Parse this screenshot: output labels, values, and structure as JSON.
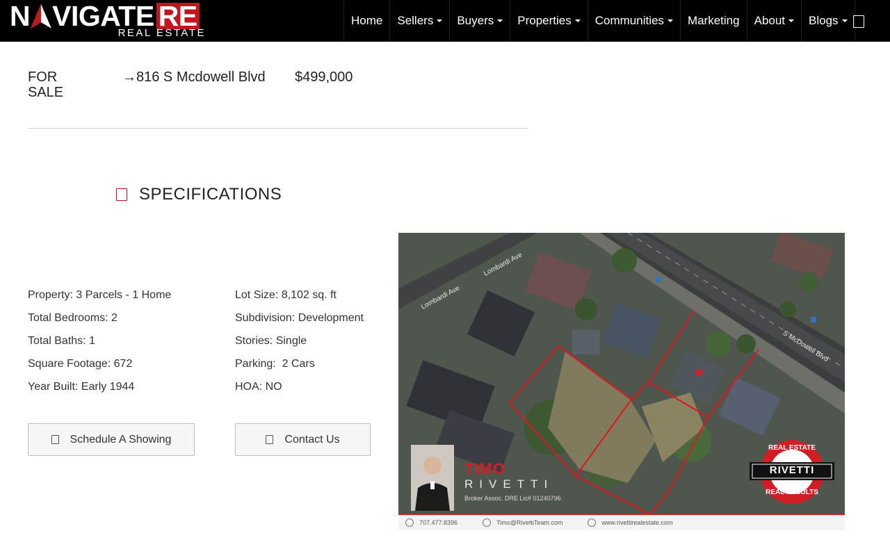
{
  "brand": {
    "logo_text_1": "N",
    "logo_text_2": "VIGATE",
    "logo_text_re": "RE",
    "logo_sub": "REAL ESTATE"
  },
  "nav": {
    "items": [
      {
        "label": "Home",
        "dropdown": false
      },
      {
        "label": "Sellers",
        "dropdown": true
      },
      {
        "label": "Buyers",
        "dropdown": true
      },
      {
        "label": "Properties",
        "dropdown": true
      },
      {
        "label": "Communities",
        "dropdown": true
      },
      {
        "label": "Marketing",
        "dropdown": false
      },
      {
        "label": "About",
        "dropdown": true
      },
      {
        "label": "Blogs",
        "dropdown": true
      }
    ],
    "search_icon": "search-icon"
  },
  "listing": {
    "status": "FOR SALE",
    "address": "→816 S Mcdowell Blvd",
    "price": "$499,000"
  },
  "specifications": {
    "title": "SPECIFICATIONS",
    "icon": "list-icon",
    "left": [
      "Property: 3 Parcels - 1 Home",
      "Total Bedrooms: 2",
      "Total Baths: 1",
      "Square Footage: 672",
      "Year Built: Early 1944"
    ],
    "right": [
      "Lot Size: 8,102 sq. ft",
      "Subdivision: Development",
      "Stories: Single",
      "Parking:  2 Cars",
      "HOA: NO"
    ]
  },
  "buttons": {
    "schedule": "Schedule A Showing",
    "contact": "Contact Us"
  },
  "photo": {
    "road_1": "Lombardi Ave",
    "road_2": "Lombardi Ave",
    "road_3": "S McDowell Blvd",
    "agent_first": "TIMO",
    "agent_last": "RIVETTI",
    "agent_license": "Broker Assoc. DRE Lic# 01240796",
    "badge_top": "REAL ESTATE",
    "badge_name": "RIVETTI",
    "badge_bottom": "REAL RESULTS",
    "phone": "707.477.8396",
    "email": "Timo@RivettiTeam.com",
    "website": "www.rivettirealestate.com",
    "accent": "#d11e25"
  },
  "colors": {
    "header_bg": "#000000",
    "brand_red": "#c1161d"
  }
}
